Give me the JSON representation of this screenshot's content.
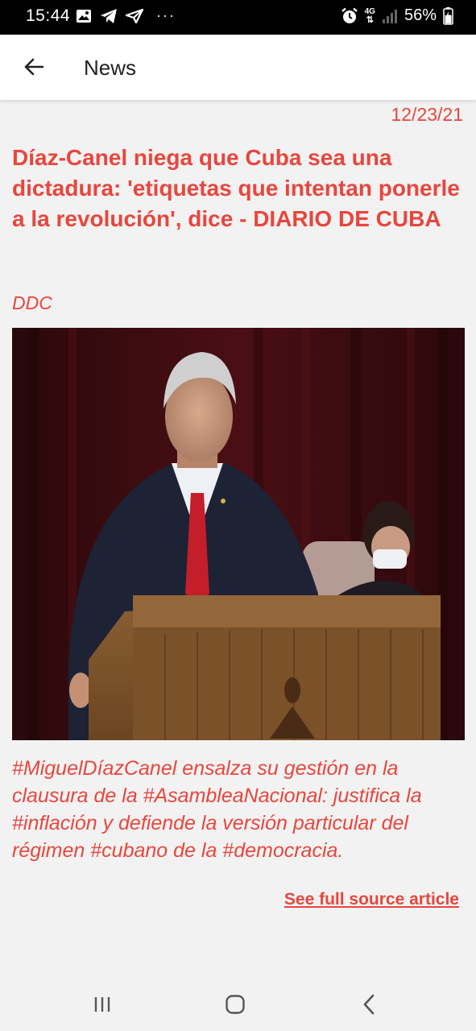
{
  "status_bar": {
    "time": "15:44",
    "network": "4G",
    "battery": "56%",
    "icons": [
      "image-icon",
      "telegram-icon",
      "telegram-outline-icon",
      "more-dots-icon",
      "alarm-icon",
      "network-4g-icon",
      "signal-icon",
      "battery-icon"
    ]
  },
  "app_bar": {
    "title": "News",
    "back_icon": "arrow-left-icon"
  },
  "article": {
    "date": "12/23/21",
    "headline": "Díaz-Canel niega que Cuba sea una dictadura: 'etiquetas que intentan ponerle a la revolución', dice - DIARIO DE CUBA",
    "source": "DDC",
    "summary": "#MiguelDíazCanel ensalza su gestión en la clausura de la #AsambleaNacional: justifica la #inflación y defiende la versión particular del régimen #cubano de la #democracia.",
    "link_label": "See full source article"
  },
  "nav_bar": {
    "buttons": [
      "recent-apps-icon",
      "home-icon",
      "back-icon"
    ]
  },
  "colors": {
    "accent": "#e8463d",
    "background": "#f2f2f2",
    "app_bar": "#ffffff",
    "status_bar": "#000000"
  }
}
